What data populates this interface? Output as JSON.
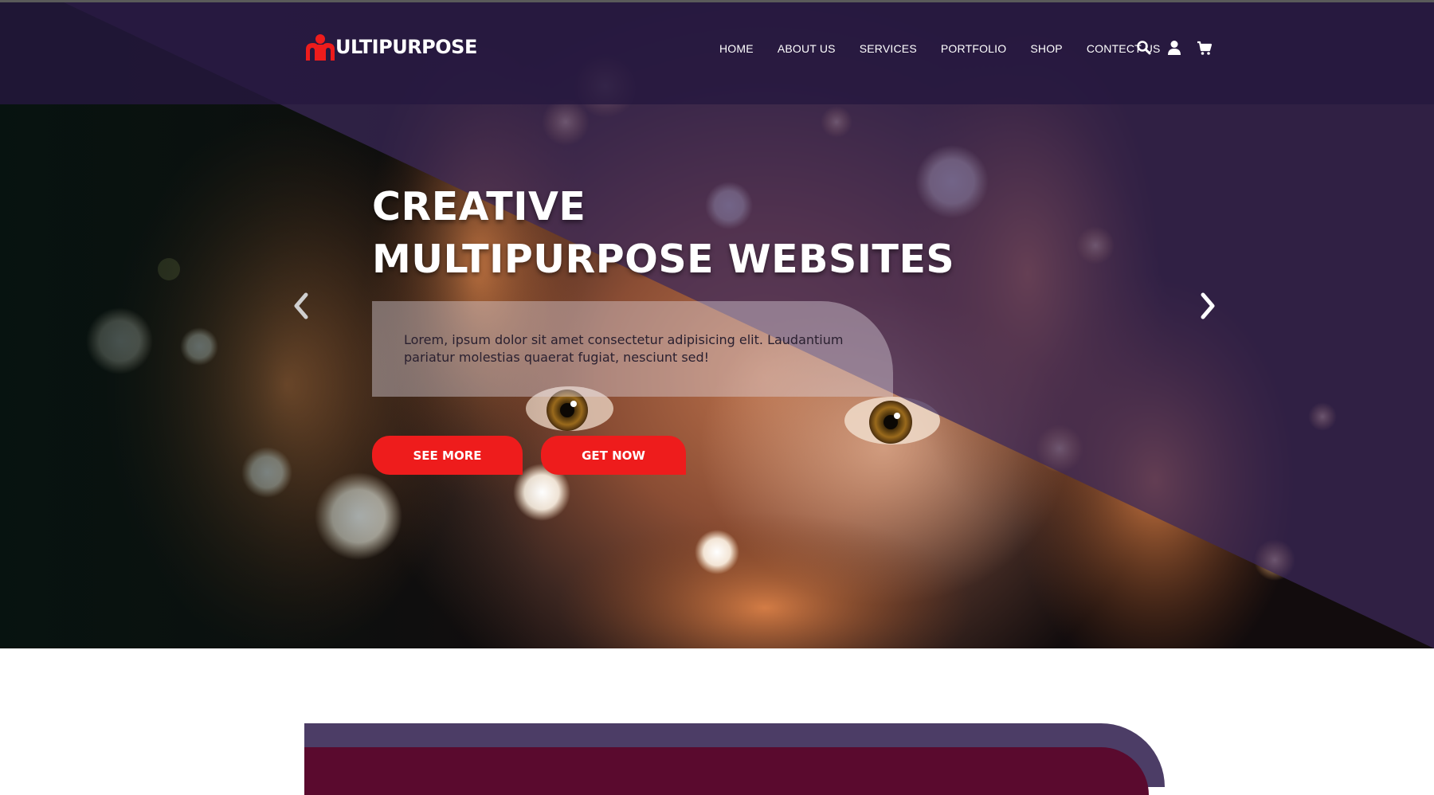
{
  "brand": {
    "logo_text": "ULTIPURPOSE",
    "logo_icon": "people-logo-icon",
    "accent_color": "#ee1c1c",
    "purple_color": "#3c285a"
  },
  "nav": {
    "items": [
      {
        "label": "HOME"
      },
      {
        "label": "ABOUT US"
      },
      {
        "label": "SERVICES"
      },
      {
        "label": "PORTFOLIO"
      },
      {
        "label": "SHOP"
      },
      {
        "label": "CONTECT US"
      }
    ],
    "icons": [
      "search-icon",
      "user-icon",
      "cart-icon"
    ]
  },
  "hero": {
    "title_line1": "CREATIVE",
    "title_line2": "MULTIPURPOSE WEBSITES",
    "description": "Lorem, ipsum dolor sit amet consectetur adipisicing elit. Laudantium pariatur molestias quaerat fugiat, nesciunt sed!",
    "buttons": {
      "see_more": "SEE MORE",
      "get_now": "GET NOW"
    },
    "prev_icon": "chevron-left-icon",
    "next_icon": "chevron-right-icon"
  }
}
